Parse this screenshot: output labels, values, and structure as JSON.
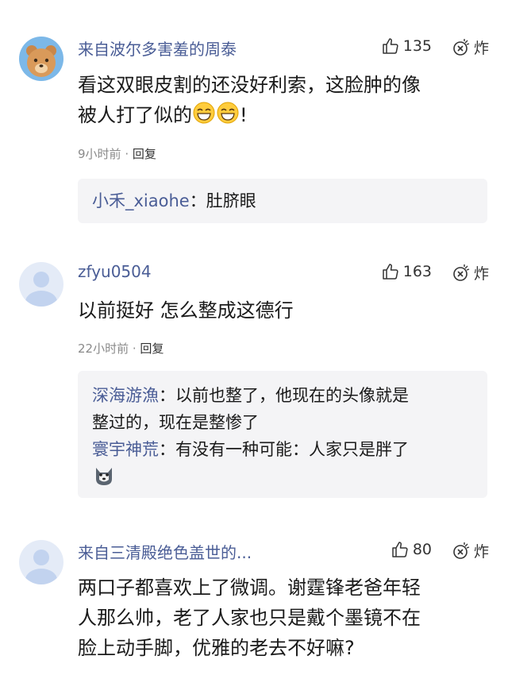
{
  "comments": [
    {
      "username": "来自波尔多害羞的周泰",
      "likes": "135",
      "bomb_label": "炸",
      "text_line1": "看这双眼皮割的还没好利索，这脸肿的像",
      "text_line2": "被人打了似的",
      "text_suffix": "!",
      "emoji": "grinning-face-emoji",
      "time": "9小时前",
      "reply_label": "回复",
      "replies": [
        {
          "name": "小禾_xiaohe",
          "sep": "：",
          "text": "肚脐眼"
        }
      ],
      "avatar": "bear-avatar"
    },
    {
      "username": "zfyu0504",
      "likes": "163",
      "bomb_label": "炸",
      "text_line1": "以前挺好 怎么整成这德行",
      "time": "22小时前",
      "reply_label": "回复",
      "replies": [
        {
          "name": "深海游漁",
          "sep": "：",
          "text": "以前也整了，他现在的头像就是",
          "text2": "整过的，现在是整惨了"
        },
        {
          "name": "寰宇神荒",
          "sep": "：",
          "text": "有没有一种可能：人家只是胖了"
        }
      ],
      "avatar": "default-avatar"
    },
    {
      "username": "来自三清殿绝色盖世的...",
      "likes": "80",
      "bomb_label": "炸",
      "text_line1": "两口子都喜欢上了微调。谢霆锋老爸年轻",
      "text_line2": "人那么帅，老了人家也只是戴个墨镜不在",
      "text_line3": "脸上动手脚，优雅的老去不好嘛?",
      "avatar": "default-avatar"
    }
  ],
  "colors": {
    "username": "#4a5d96",
    "reply_bg": "#f4f4f6",
    "meta": "#8a8a8a"
  }
}
